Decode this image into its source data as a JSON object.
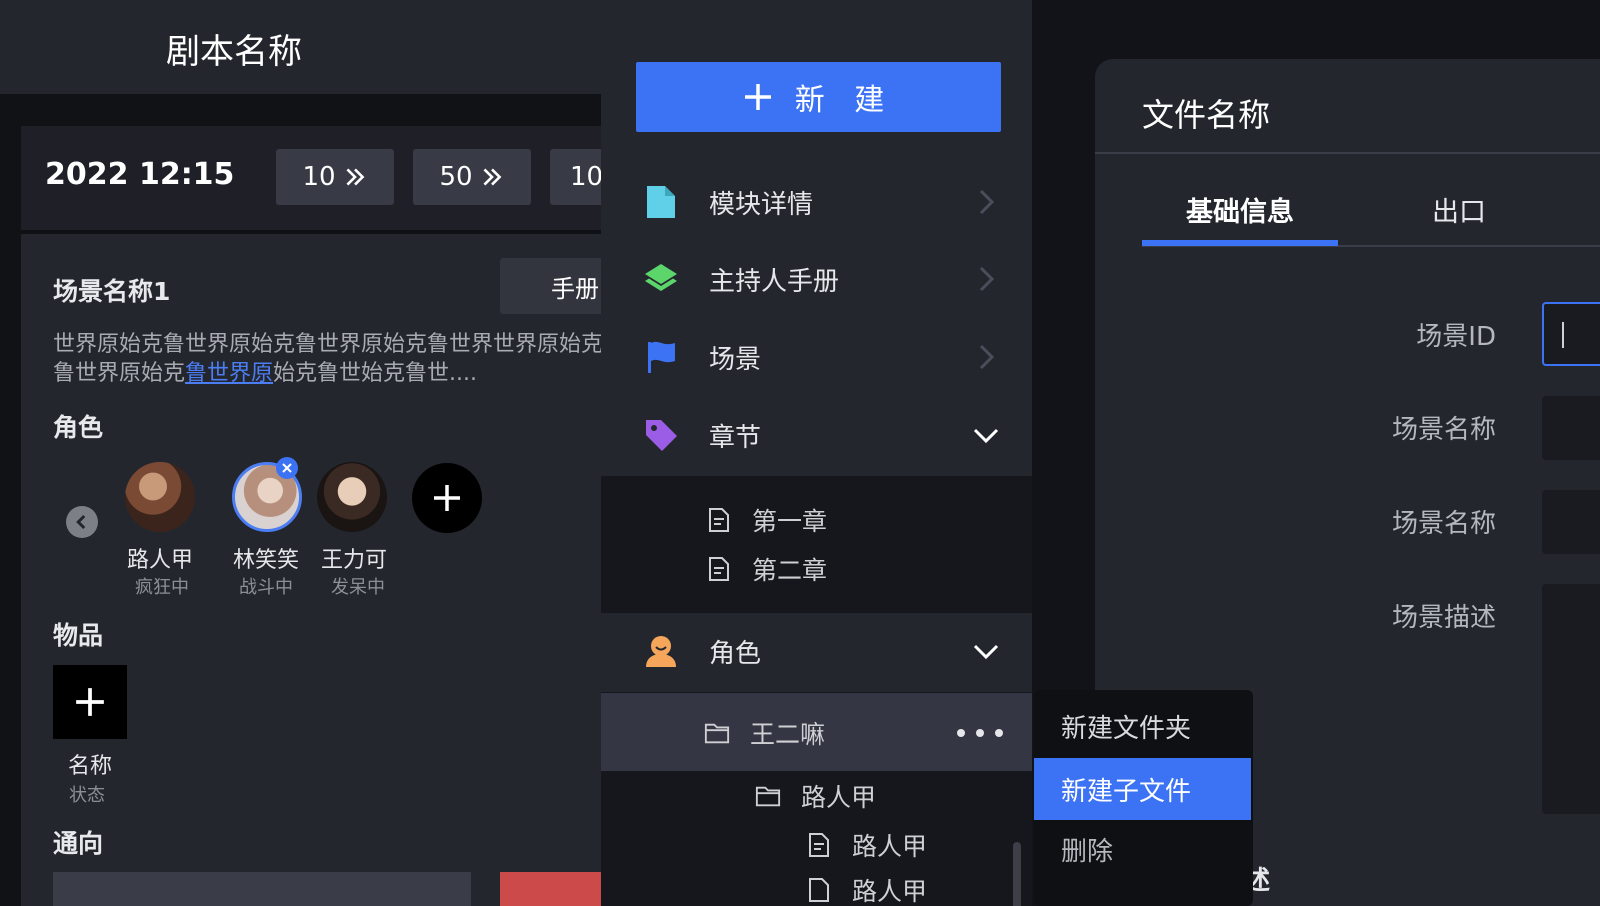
{
  "left": {
    "script_title": "剧本名称",
    "datetime": "2022 12:15",
    "jumps": [
      "10",
      "50",
      "10"
    ],
    "scene_name": "场景名称1",
    "manual_btn": "手册",
    "scene_desc_pre": "世界原始克鲁世界原始克鲁世界原始克鲁世界世界原始克鲁世界原始克",
    "scene_desc_link": "鲁世界原",
    "scene_desc_post": "始克鲁世始克鲁世....",
    "roles_title": "角色",
    "roles": [
      {
        "name": "路人甲",
        "status": "疯狂中"
      },
      {
        "name": "林笑笑",
        "status": "战斗中"
      },
      {
        "name": "王力可",
        "status": "发呆中"
      }
    ],
    "items_title": "物品",
    "item": {
      "name": "名称",
      "status": "状态"
    },
    "routes_title": "通向"
  },
  "tree": {
    "new_btn": "新 建",
    "menu": [
      {
        "label": "模块详情",
        "icon": "file-icon",
        "color": "#5fd0e8"
      },
      {
        "label": "主持人手册",
        "icon": "layers-icon",
        "color": "#5cd66b"
      },
      {
        "label": "场景",
        "icon": "flag-icon",
        "color": "#3c73f5"
      },
      {
        "label": "章节",
        "icon": "tag-icon",
        "color": "#9b5de5"
      },
      {
        "label": "角色",
        "icon": "person-icon",
        "color": "#f5a65b"
      }
    ],
    "chapters": [
      "第一章",
      "第二章"
    ],
    "folder_wang": "王二嘛",
    "folder_luren": "路人甲",
    "file_luren": "路人甲",
    "file_luren2": "路人甲"
  },
  "context_menu": {
    "new_folder": "新建文件夹",
    "new_child_file": "新建子文件",
    "delete": "删除"
  },
  "right": {
    "file_title": "文件名称",
    "tabs": [
      "基础信息",
      "出口"
    ],
    "form_labels": [
      "场景ID",
      "场景名称",
      "场景名称",
      "场景描述"
    ],
    "section_cut": "物品描述"
  },
  "colors": {
    "accent": "#3c73f5",
    "panel": "#24262e",
    "bg": "#121318"
  }
}
